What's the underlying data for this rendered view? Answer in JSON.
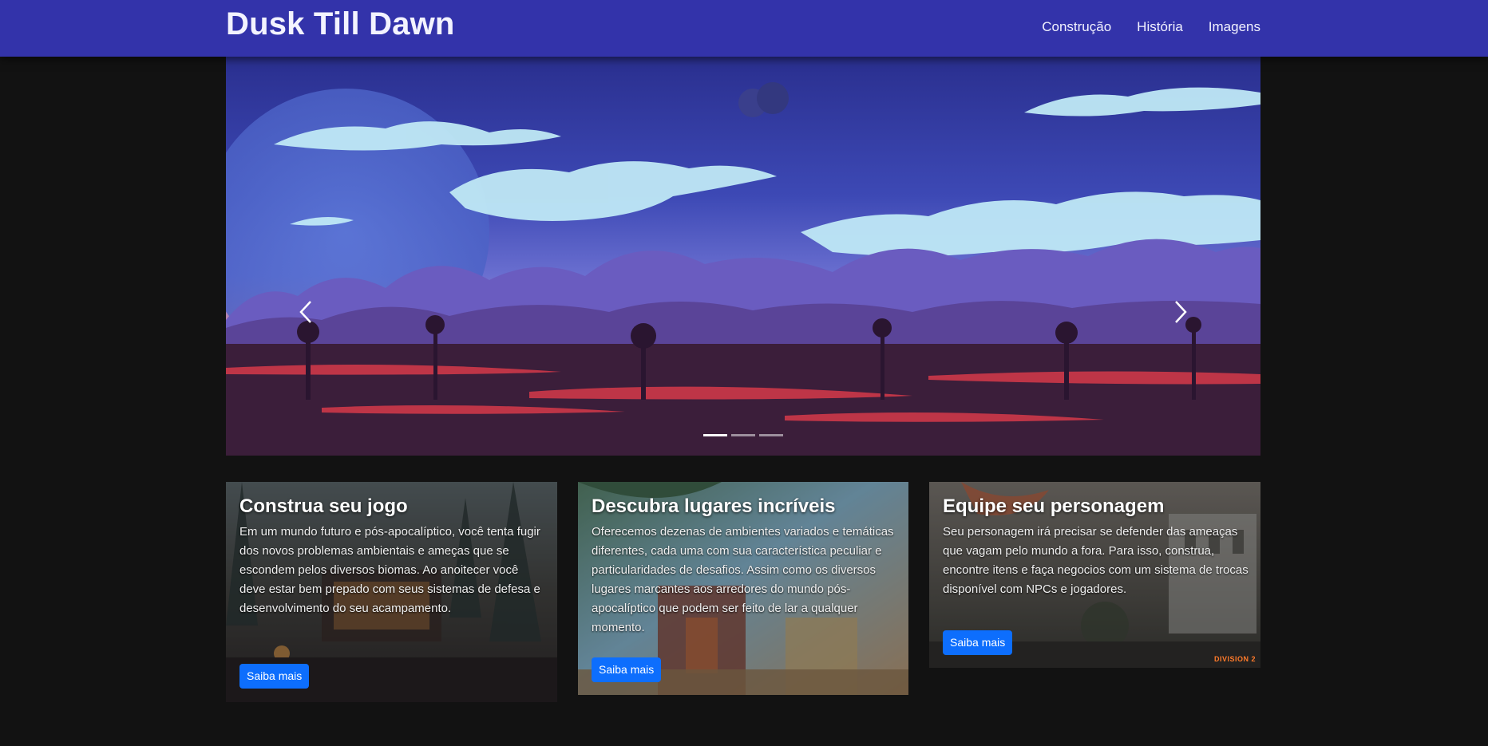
{
  "header": {
    "brand": "Dusk Till Dawn",
    "nav": [
      "Construção",
      "História",
      "Imagens"
    ]
  },
  "carousel": {
    "prev_icon": "chevron-left-icon",
    "next_icon": "chevron-right-icon",
    "slide_count": 3,
    "active_slide": 1
  },
  "cards": [
    {
      "title": "Construa seu jogo",
      "text": "Em um mundo futuro e pós-apocalíptico, você tenta fugir dos novos problemas ambientais e ameças que se escondem pelos diversos biomas. Ao anoitecer você deve estar bem prepado com seus sistemas de defesa e desenvolvimento do seu acampamento.",
      "button": "Saiba mais"
    },
    {
      "title": "Descubra lugares incríveis",
      "text": "Oferecemos dezenas de ambientes variados e temáticas diferentes, cada uma com sua característica peculiar e particularidades de desafios. Assim como os diversos lugares marcantes aos arredores do mundo pós-apocalíptico que podem ser feito de lar a qualquer momento.",
      "button": "Saiba mais"
    },
    {
      "title": "Equipe seu personagem",
      "text": "Seu personagem irá precisar se defender das ameaças que vagam pelo mundo a fora. Para isso, construa, encontre itens e faça negocios com um sistema de trocas disponível com NPCs e jogadores.",
      "button": "Saiba mais",
      "logo": "DIVISION 2"
    }
  ],
  "colors": {
    "navbar": "#3333aa",
    "page_bg": "#121212",
    "button": "#0d6efd"
  }
}
